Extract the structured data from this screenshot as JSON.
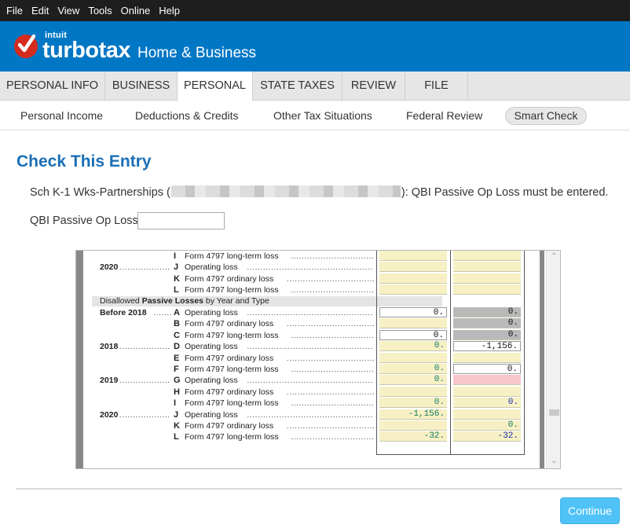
{
  "menubar": {
    "items": [
      "File",
      "Edit",
      "View",
      "Tools",
      "Online",
      "Help"
    ]
  },
  "brand": {
    "company": "intuit",
    "product": "turbotax",
    "edition": "Home & Business",
    "color": "#0077c5",
    "logo_color": "#d52b1e"
  },
  "tabs": [
    {
      "label": "PERSONAL INFO",
      "active": false
    },
    {
      "label": "BUSINESS",
      "active": false
    },
    {
      "label": "PERSONAL",
      "active": true
    },
    {
      "label": "STATE TAXES",
      "active": false
    },
    {
      "label": "REVIEW",
      "active": false
    },
    {
      "label": "FILE",
      "active": false
    }
  ],
  "subnav": {
    "items": [
      "Personal Income",
      "Deductions & Credits",
      "Other Tax Situations",
      "Federal Review"
    ],
    "smart_check": "Smart Check"
  },
  "main": {
    "title": "Check This Entry",
    "message_prefix": "Sch K-1 Wks-Partnerships (",
    "message_suffix": "): QBI Passive Op Loss must be entered.",
    "field_label": "QBI Passive Op Loss",
    "field_value": ""
  },
  "form": {
    "section_header_prefix": "Disallowed ",
    "section_header_bold": "Passive Losses",
    "section_header_suffix": " by Year and Type",
    "rows": [
      {
        "year": "",
        "letter": "I",
        "desc": "Form 4797 long-term loss",
        "c1": "",
        "c1_style": "y",
        "c2": "",
        "c2_style": "y"
      },
      {
        "year": "2020",
        "letter": "J",
        "desc": "Operating loss",
        "c1": "",
        "c1_style": "y",
        "c2": "",
        "c2_style": "y"
      },
      {
        "year": "",
        "letter": "K",
        "desc": "Form 4797 ordinary loss",
        "c1": "",
        "c1_style": "y",
        "c2": "",
        "c2_style": "y"
      },
      {
        "year": "",
        "letter": "L",
        "desc": "Form 4797 long-term loss",
        "c1": "",
        "c1_style": "y",
        "c2": "",
        "c2_style": "y"
      },
      {
        "year": "__header__",
        "letter": "",
        "desc": "",
        "c1": "",
        "c1_style": "",
        "c2": "",
        "c2_style": ""
      },
      {
        "year": "Before 2018",
        "letter": "A",
        "desc": "Operating loss",
        "c1": "0.",
        "c1_style": "w black",
        "c2": "0.",
        "c2_style": "g black"
      },
      {
        "year": "",
        "letter": "B",
        "desc": "Form 4797 ordinary loss",
        "c1": "",
        "c1_style": "y",
        "c2": "0.",
        "c2_style": "g black"
      },
      {
        "year": "",
        "letter": "C",
        "desc": "Form 4797 long-term loss",
        "c1": "0.",
        "c1_style": "w black",
        "c2": "0.",
        "c2_style": "g black"
      },
      {
        "year": "2018",
        "letter": "D",
        "desc": "Operating loss",
        "c1": "0.",
        "c1_style": "y teal",
        "c2": "-1,156.",
        "c2_style": "w black"
      },
      {
        "year": "",
        "letter": "E",
        "desc": "Form 4797 ordinary loss",
        "c1": "",
        "c1_style": "y",
        "c2": "",
        "c2_style": "y"
      },
      {
        "year": "",
        "letter": "F",
        "desc": "Form 4797 long-term loss",
        "c1": "0.",
        "c1_style": "y teal",
        "c2": "0.",
        "c2_style": "w black"
      },
      {
        "year": "2019",
        "letter": "G",
        "desc": "Operating loss",
        "c1": "0.",
        "c1_style": "y teal",
        "c2": "",
        "c2_style": "p"
      },
      {
        "year": "",
        "letter": "H",
        "desc": "Form 4797 ordinary loss",
        "c1": "",
        "c1_style": "y",
        "c2": "",
        "c2_style": "y"
      },
      {
        "year": "",
        "letter": "I",
        "desc": "Form 4797 long-term loss",
        "c1": "0.",
        "c1_style": "y teal",
        "c2": "0.",
        "c2_style": "y blue"
      },
      {
        "year": "2020",
        "letter": "J",
        "desc": "Operating loss",
        "c1": "-1,156.",
        "c1_style": "y teal",
        "c2": "",
        "c2_style": "y"
      },
      {
        "year": "",
        "letter": "K",
        "desc": "Form 4797 ordinary loss",
        "c1": "",
        "c1_style": "y",
        "c2": "0.",
        "c2_style": "y teal"
      },
      {
        "year": "",
        "letter": "L",
        "desc": "Form 4797 long-term loss",
        "c1": "-32.",
        "c1_style": "y teal",
        "c2": "-32.",
        "c2_style": "y blue"
      }
    ]
  },
  "footer": {
    "continue_label": "Continue",
    "button_color": "#4fc3f7"
  }
}
